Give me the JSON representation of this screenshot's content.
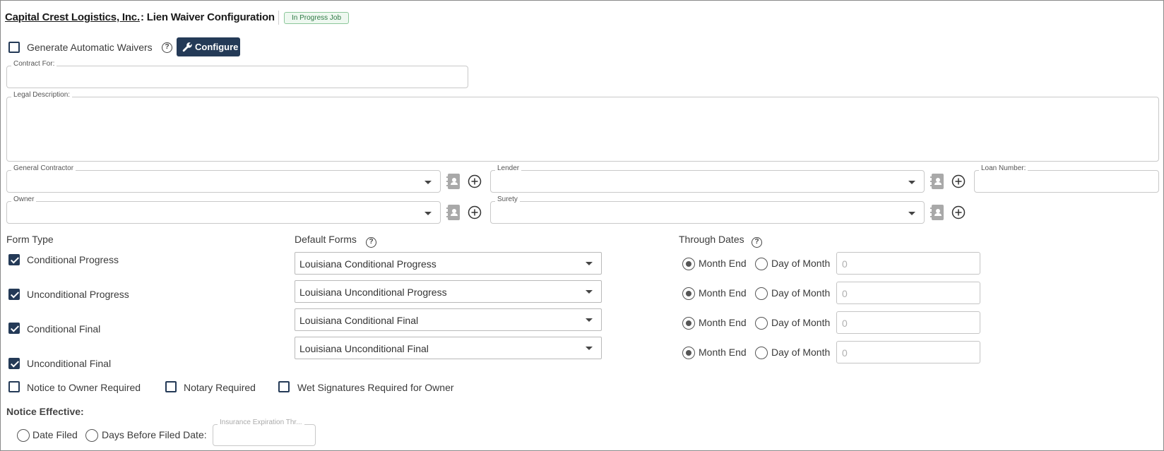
{
  "header": {
    "company_name": "Capital Crest Logistics, Inc.",
    "separator_title": ": Lien Waiver Configuration",
    "status_badge": "In Progress Job"
  },
  "auto_waivers": {
    "label": "Generate Automatic Waivers",
    "checked": false,
    "configure_label": "Configure"
  },
  "fields": {
    "contract_for": "Contract For:",
    "legal_description": "Legal Description:",
    "general_contractor": "General Contractor",
    "lender": "Lender",
    "loan_number": "Loan Number:",
    "owner": "Owner",
    "surety": "Surety"
  },
  "form_type": {
    "title": "Form Type",
    "items": [
      {
        "label": "Conditional Progress",
        "checked": true
      },
      {
        "label": "Unconditional Progress",
        "checked": true
      },
      {
        "label": "Conditional Final",
        "checked": true
      },
      {
        "label": "Unconditional Final",
        "checked": true
      }
    ]
  },
  "default_forms": {
    "title": "Default Forms",
    "items": [
      "Louisiana Conditional Progress",
      "Louisiana Unconditional Progress",
      "Louisiana Conditional Final",
      "Louisiana Unconditional Final"
    ]
  },
  "through_dates": {
    "title": "Through Dates",
    "month_end_label": "Month End",
    "day_of_month_label": "Day of Month",
    "rows": [
      {
        "selected": "month_end",
        "day_value": "0"
      },
      {
        "selected": "month_end",
        "day_value": "0"
      },
      {
        "selected": "month_end",
        "day_value": "0"
      },
      {
        "selected": "month_end",
        "day_value": "0"
      }
    ]
  },
  "requirements": {
    "notice_to_owner": "Notice to Owner Required",
    "notary": "Notary Required",
    "wet_signatures": "Wet Signatures Required for Owner"
  },
  "notice_effective": {
    "title": "Notice Effective:",
    "date_filed": "Date Filed",
    "days_before": "Days Before Filed Date:",
    "insurance_field": "Insurance Expiration Thr..."
  },
  "colors": {
    "primary": "#243a57",
    "badge_green": "#2f7a45"
  }
}
